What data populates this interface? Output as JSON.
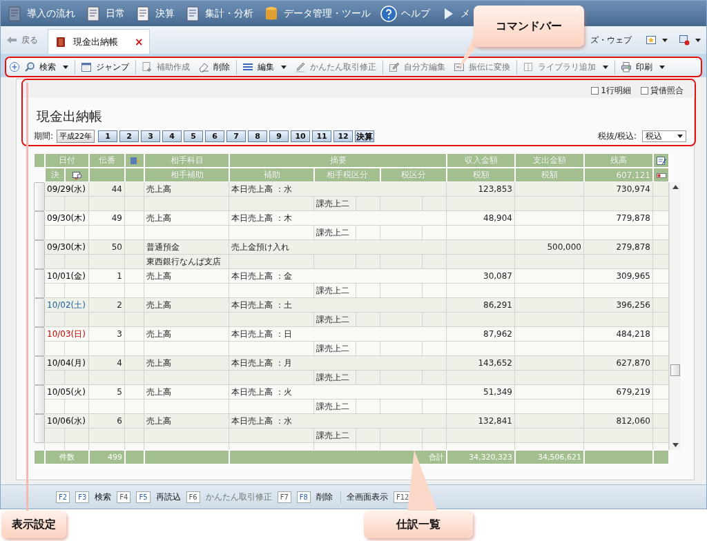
{
  "menu": [
    {
      "label": "導入の流れ"
    },
    {
      "label": "日常"
    },
    {
      "label": "決算"
    },
    {
      "label": "集計・分析"
    },
    {
      "label": "データ管理・ツール"
    },
    {
      "label": "ヘルプ"
    },
    {
      "label": "メ"
    }
  ],
  "tabbar": {
    "back": "戻る",
    "tab": {
      "label": "現金出納帳",
      "close": "×",
      "selected": true
    },
    "right_link": "ズ・ウェブ"
  },
  "toolbar": [
    {
      "label": "検索",
      "disabled": false,
      "dropdown": true,
      "separator_before": false
    },
    {
      "label": "ジャンプ",
      "disabled": false,
      "dropdown": false,
      "separator_before": true
    },
    {
      "label": "補助作成",
      "disabled": true,
      "dropdown": false,
      "separator_before": true
    },
    {
      "label": "削除",
      "disabled": false,
      "dropdown": false,
      "separator_before": false
    },
    {
      "label": "編集",
      "disabled": false,
      "dropdown": true,
      "separator_before": true
    },
    {
      "label": "かんたん取引修正",
      "disabled": true,
      "dropdown": false,
      "separator_before": false
    },
    {
      "label": "自分方編集",
      "disabled": true,
      "dropdown": false,
      "separator_before": true
    },
    {
      "label": "振伝に変換",
      "disabled": true,
      "dropdown": false,
      "separator_before": false
    },
    {
      "label": "ライブラリ追加",
      "disabled": true,
      "dropdown": true,
      "separator_before": true
    },
    {
      "label": "印刷",
      "disabled": false,
      "dropdown": true,
      "separator_before": true
    }
  ],
  "options": [
    {
      "label": "1行明細",
      "checked": false
    },
    {
      "label": "貸借照合",
      "checked": false
    }
  ],
  "title": "現金出納帳",
  "period": {
    "label": "期間:",
    "year": "平成22年",
    "months": [
      "1",
      "2",
      "3",
      "4",
      "5",
      "6",
      "7",
      "8",
      "9",
      "10",
      "11",
      "12"
    ],
    "closing": "決算"
  },
  "tax_mode": {
    "label": "税抜/税込:",
    "value": "税込"
  },
  "table": {
    "header1": [
      "日付",
      "伝番",
      "相手科目",
      "摘要",
      "収入金額",
      "支出金額",
      "残高"
    ],
    "header2": [
      "決",
      "相手補助",
      "補助",
      "相手税区分",
      "税区分",
      "税額",
      "税額",
      "607,121"
    ],
    "rows": [
      {
        "date": "09/29(水)",
        "color": "#000000",
        "number": "44",
        "account": "売上高",
        "summary": "本日売上高 ：水",
        "income": "123,853",
        "balance": "730,974",
        "partner_tax": "課売上二"
      },
      {
        "date": "09/30(木)",
        "color": "#000000",
        "number": "49",
        "account": "売上高",
        "summary": "本日売上高 ：木",
        "income": "48,904",
        "balance": "779,878",
        "partner_tax": "課売上二"
      },
      {
        "date": "09/30(木)",
        "color": "#000000",
        "number": "50",
        "account": "普通預金",
        "summary": "売上金預け入れ",
        "expense": "500,000",
        "balance": "279,878",
        "sub_account": "東西銀行なんば支店"
      },
      {
        "date": "10/01(金)",
        "color": "#000000",
        "number": "1",
        "account": "売上高",
        "summary": "本日売上高 ：金",
        "income": "30,087",
        "balance": "309,965",
        "partner_tax": "課売上二"
      },
      {
        "date": "10/02(土)",
        "color": "#1f5fa0",
        "number": "2",
        "account": "売上高",
        "summary": "本日売上高 ：土",
        "income": "86,291",
        "balance": "396,256",
        "partner_tax": "課売上二"
      },
      {
        "date": "10/03(日)",
        "color": "#c00000",
        "number": "3",
        "account": "売上高",
        "summary": "本日売上高 ：日",
        "income": "87,962",
        "balance": "484,218",
        "partner_tax": "課売上二"
      },
      {
        "date": "10/04(月)",
        "color": "#000000",
        "number": "4",
        "account": "売上高",
        "summary": "本日売上高 ：月",
        "income": "143,652",
        "balance": "627,870",
        "partner_tax": "課売上二"
      },
      {
        "date": "10/05(火)",
        "color": "#000000",
        "number": "5",
        "account": "売上高",
        "summary": "本日売上高 ：火",
        "income": "51,349",
        "balance": "679,219",
        "partner_tax": "課売上二"
      },
      {
        "date": "10/06(水)",
        "color": "#000000",
        "number": "6",
        "account": "売上高",
        "summary": "本日売上高 ：水",
        "income": "132,841",
        "balance": "812,060",
        "partner_tax": "課売上二"
      }
    ],
    "totals": {
      "count_label": "件数",
      "count": "499",
      "sum_label": "合計",
      "income": "34,320,323",
      "expense": "34,506,621"
    }
  },
  "fkeys": [
    {
      "key": "F2",
      "disabled": false
    },
    {
      "key": "F3",
      "label": "検索",
      "disabled": false
    },
    {
      "key": "F4",
      "disabled": true
    },
    {
      "key": "F5",
      "label": "再読込",
      "disabled": false
    },
    {
      "key": "F6",
      "label": "かんたん取引修正",
      "disabled": true
    },
    {
      "key": "F7",
      "disabled": true
    },
    {
      "key": "F8",
      "label": "削除",
      "disabled": false
    },
    {
      "label": "全画面表示",
      "disabled": false,
      "separator_before": true
    },
    {
      "key": "F12",
      "disabled": true
    }
  ],
  "callouts": [
    {
      "text": "コマンドバー"
    },
    {
      "text": "表示設定"
    },
    {
      "text": "仕訳一覧"
    }
  ]
}
